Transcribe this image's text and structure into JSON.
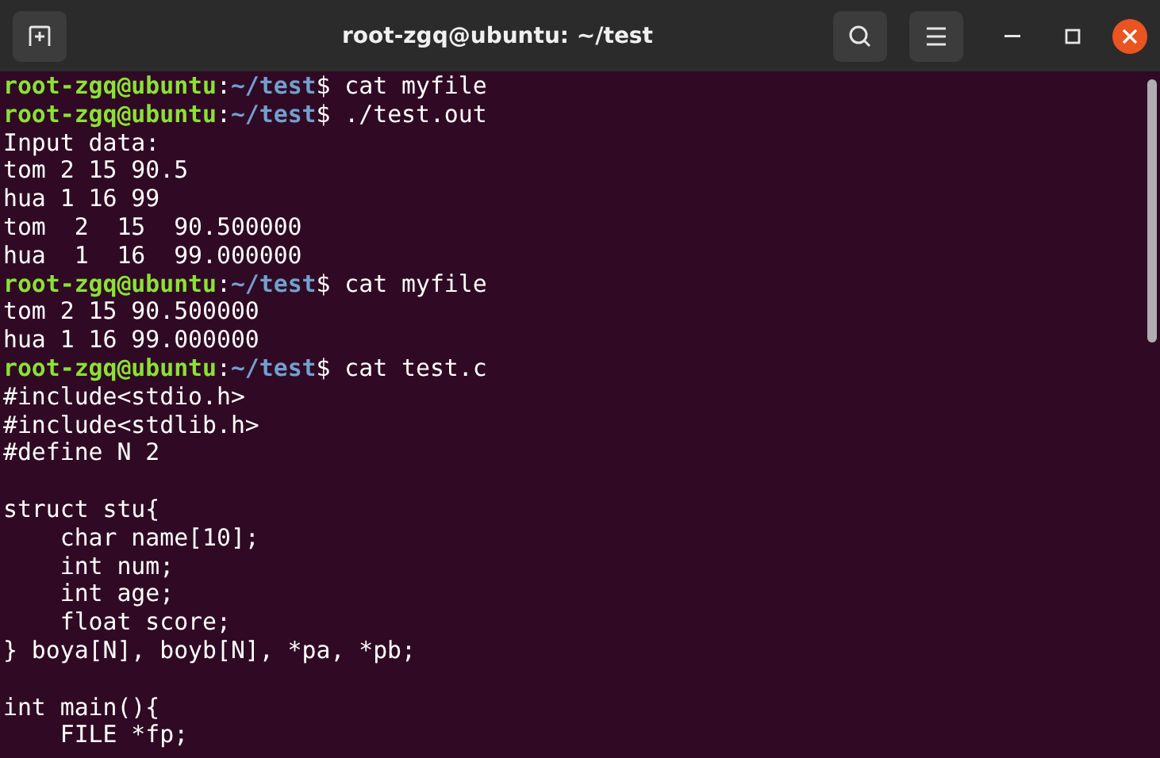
{
  "window": {
    "title": "root-zgq@ubuntu: ~/test"
  },
  "terminal": {
    "lines": [
      {
        "kind": "prompt",
        "user": "root-zgq@ubuntu",
        "sep": ":",
        "path": "~/test",
        "sign": "$",
        "command": " cat myfile"
      },
      {
        "kind": "prompt",
        "user": "root-zgq@ubuntu",
        "sep": ":",
        "path": "~/test",
        "sign": "$",
        "command": " ./test.out"
      },
      {
        "kind": "output",
        "text": "Input data:"
      },
      {
        "kind": "output",
        "text": "tom 2 15 90.5"
      },
      {
        "kind": "output",
        "text": "hua 1 16 99"
      },
      {
        "kind": "output",
        "text": "tom  2  15  90.500000"
      },
      {
        "kind": "output",
        "text": "hua  1  16  99.000000"
      },
      {
        "kind": "prompt",
        "user": "root-zgq@ubuntu",
        "sep": ":",
        "path": "~/test",
        "sign": "$",
        "command": " cat myfile"
      },
      {
        "kind": "output",
        "text": "tom 2 15 90.500000"
      },
      {
        "kind": "output",
        "text": "hua 1 16 99.000000"
      },
      {
        "kind": "prompt",
        "user": "root-zgq@ubuntu",
        "sep": ":",
        "path": "~/test",
        "sign": "$",
        "command": " cat test.c"
      },
      {
        "kind": "output",
        "text": "#include<stdio.h>"
      },
      {
        "kind": "output",
        "text": "#include<stdlib.h>"
      },
      {
        "kind": "output",
        "text": "#define N 2"
      },
      {
        "kind": "blank"
      },
      {
        "kind": "output",
        "text": "struct stu{"
      },
      {
        "kind": "output",
        "text": "    char name[10];"
      },
      {
        "kind": "output",
        "text": "    int num;"
      },
      {
        "kind": "output",
        "text": "    int age;"
      },
      {
        "kind": "output",
        "text": "    float score;"
      },
      {
        "kind": "output",
        "text": "} boya[N], boyb[N], *pa, *pb;"
      },
      {
        "kind": "blank"
      },
      {
        "kind": "output",
        "text": "int main(){"
      },
      {
        "kind": "output",
        "text": "    FILE *fp;"
      }
    ]
  }
}
